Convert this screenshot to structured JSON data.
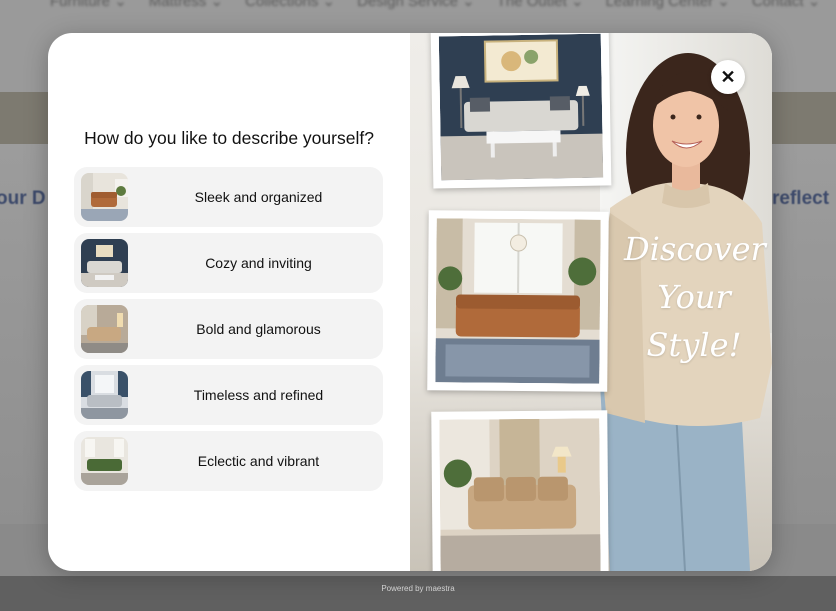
{
  "background": {
    "nav_items": [
      "Furniture ⌄",
      "Mattress ⌄",
      "Collections ⌄",
      "Design Service ⌄",
      "The Outlet ⌄",
      "Learning Center ⌄",
      "Contact ⌄"
    ],
    "left_text": "our D",
    "right_text": "reflect"
  },
  "modal": {
    "question": "How do you like to describe yourself?",
    "options": [
      {
        "label": "Sleek and organized",
        "thumb": "living-room-rust-sofa"
      },
      {
        "label": "Cozy and inviting",
        "thumb": "living-room-navy-wall"
      },
      {
        "label": "Bold and glamorous",
        "thumb": "living-room-tan-sofa"
      },
      {
        "label": "Timeless and refined",
        "thumb": "living-room-grey-sofa"
      },
      {
        "label": "Eclectic and vibrant",
        "thumb": "living-room-green-sofa"
      }
    ],
    "close_icon": "close-icon",
    "close_symbol": "✕",
    "tagline_lines": [
      "Discover",
      "Your",
      "Style!"
    ]
  },
  "footer": {
    "powered_by": "Powered by maestra"
  },
  "colors": {
    "overlay": "#6f6f6f",
    "option_bg": "#f3f3f3",
    "navy_wall": "#2f3f52",
    "rust_sofa": "#b06a3a",
    "tan_sofa": "#c8a882",
    "green_sofa": "#4a6a36"
  }
}
